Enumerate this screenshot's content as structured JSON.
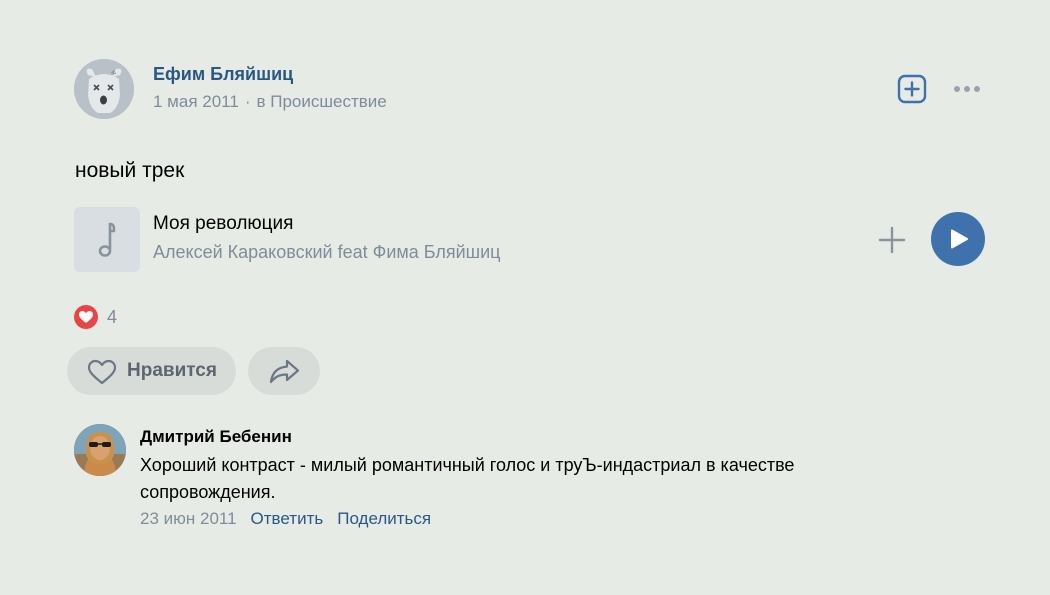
{
  "post": {
    "author_name": "Ефим Бляйшиц",
    "date": "1 мая 2011",
    "separator": "·",
    "category": "в Происшествие",
    "text": "новый трек",
    "likes_count": "4"
  },
  "audio": {
    "title": "Моя революция",
    "artist": "Алексей Караковский feat Фима Бляйшиц"
  },
  "actions": {
    "like_label": "Нравится"
  },
  "comment": {
    "author": "Дмитрий Бебенин",
    "text": "Хороший контраст - милый романтичный голос и труЪ-индастриал в качестве сопровождения.",
    "date": "23 июн 2011",
    "reply_label": "Ответить",
    "share_label": "Поделиться"
  },
  "colors": {
    "background": "#e6ebe6",
    "link": "#2a5885",
    "secondary_text": "#818c99",
    "accent": "#3f72ad",
    "like_red": "#e64646"
  },
  "icons": {
    "add_post": "plus-square-icon",
    "more": "more-horizontal-icon",
    "audio_cover": "music-note-icon",
    "audio_add": "plus-icon",
    "play": "play-icon",
    "like_badge": "heart-filled-icon",
    "like": "heart-outline-icon",
    "share": "share-arrow-icon"
  }
}
